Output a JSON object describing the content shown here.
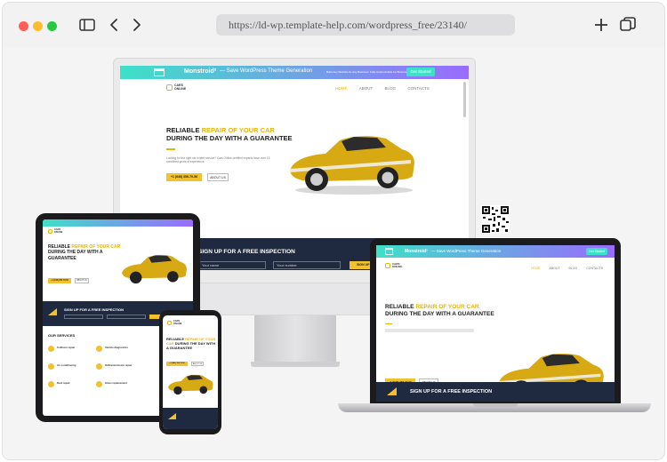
{
  "browser": {
    "url": "https://ld-wp.template-help.com/wordpress_free/23140/",
    "controls": [
      "close-dot",
      "minimize-dot",
      "maximize-dot"
    ]
  },
  "colors": {
    "accent": "#f2c12e",
    "navy": "#1f2940",
    "banner_start": "#3ee0c8",
    "banner_end": "#9a6bff"
  },
  "desktop": {
    "banner_brand": "Monstroid²",
    "banner_text": "— Save WordPress Theme Generation",
    "banner_right": "Build Any Website for Any Business. Fully Customizable for Business Builder",
    "banner_button": "Get Started",
    "logo_line1": "CARS",
    "logo_line2": "ONLINE",
    "nav": [
      "HOME",
      "ABOUT",
      "BLOG",
      "CONTACTS"
    ],
    "hero_line1_a": "RELIABLE",
    "hero_line1_b": "REPAIR OF YOUR CAR",
    "hero_line2": "DURING THE DAY WITH A GUARANTEE",
    "hero_desc": "Looking for the right car expert service? Cars Online certified experts have over 15 combined years of experience.",
    "phone_button": "+1 (646) 356-79-56",
    "about_button": "ABOUT US",
    "signup_title": "SIGN UP FOR A FREE INSPECTION",
    "field_name": "Your name",
    "field_number": "Your number",
    "signup_button": "SIGN UP NOW"
  },
  "tablet": {
    "logo_line1": "CARS",
    "logo_line2": "ONLINE",
    "hero_line1_a": "RELIABLE",
    "hero_line1_b": "REPAIR OF YOUR CAR",
    "hero_line2": "DURING THE DAY WITH A",
    "hero_line3": "GUARANTEE",
    "phone_button": "+1 (646) 356-79-56",
    "about_button": "ABOUT US",
    "signup_title": "SIGN UP FOR A FREE INSPECTION",
    "services_title": "OUR SERVICES",
    "services": [
      "Collision repair",
      "Vehicle diagnostics",
      "Air conditioning",
      "Oil/transmission repair",
      "Dent repair",
      "Glass replacement"
    ]
  },
  "phone": {
    "logo_line1": "CARS",
    "logo_line2": "ONLINE",
    "hero_line1_a": "RELIABLE",
    "hero_line1_b": "REPAIR OF YOUR",
    "hero_line2_a": "CAR",
    "hero_line2_b": "DURING THE DAY WITH",
    "hero_line3": "A GUARANTEE",
    "phone_button": "+1 (646) 356-79-56",
    "about_button": "ABOUT US"
  },
  "laptop": {
    "banner_brand": "Monstroid²",
    "banner_text": "— Save WordPress Theme Generation",
    "banner_button": "Get Started",
    "logo_line1": "CARS",
    "logo_line2": "ONLINE",
    "nav": [
      "HOME",
      "ABOUT",
      "BLOG",
      "CONTACTS"
    ],
    "hero_line1_a": "RELIABLE",
    "hero_line1_b": "REPAIR OF YOUR CAR",
    "hero_line2": "DURING THE DAY WITH A GUARANTEE",
    "phone_button": "+1 (646) 356-79-56",
    "about_button": "ABOUT US",
    "signup_title": "SIGN UP FOR A FREE INSPECTION"
  }
}
